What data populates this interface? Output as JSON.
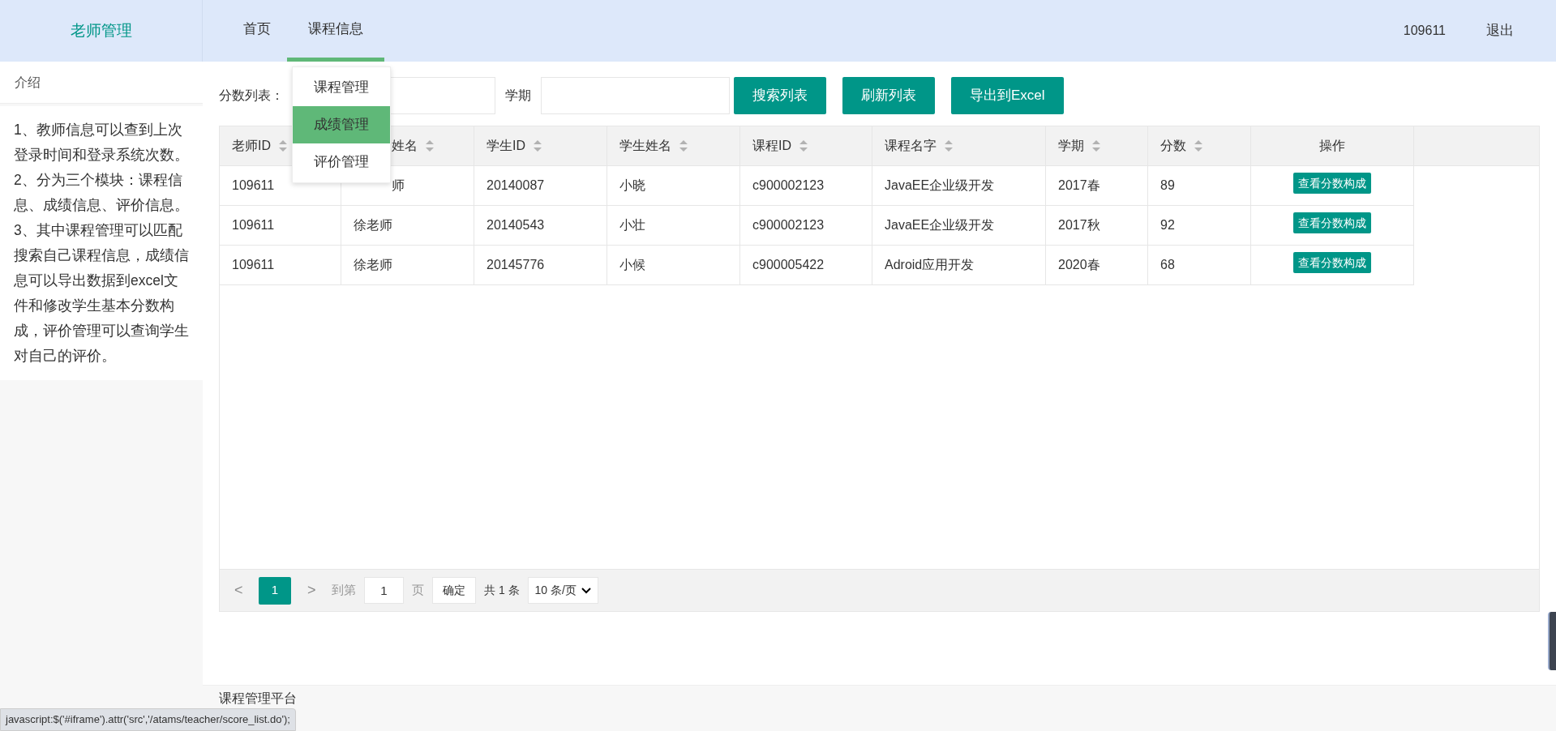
{
  "header": {
    "logo": "老师管理",
    "nav": [
      {
        "label": "首页",
        "selected": false
      },
      {
        "label": "课程信息",
        "selected": true
      }
    ],
    "user": "109611",
    "logout": "退出"
  },
  "dropdown": [
    {
      "label": "课程管理",
      "selected": false
    },
    {
      "label": "成绩管理",
      "selected": true
    },
    {
      "label": "评价管理",
      "selected": false
    }
  ],
  "sidebar": {
    "title": "介绍",
    "paragraphs": [
      "1、教师信息可以查到上次登录时间和登录系统次数。",
      "2、分为三个模块：课程信息、成绩信息、评价信息。",
      "3、其中课程管理可以匹配搜索自己课程信息，成绩信息可以导出数据到excel文件和修改学生基本分数构成，评价管理可以查询学生对自己的评价。"
    ]
  },
  "toolbar": {
    "label": "分数列表：",
    "term_label": "学期",
    "buttons": [
      "搜索列表",
      "刷新列表",
      "导出到Excel"
    ]
  },
  "table": {
    "columns": [
      {
        "label": "老师ID"
      },
      {
        "label": "姓名",
        "clipped": true
      },
      {
        "label": "学生ID"
      },
      {
        "label": "学生姓名"
      },
      {
        "label": "课程ID"
      },
      {
        "label": "课程名字"
      },
      {
        "label": "学期"
      },
      {
        "label": "分数"
      },
      {
        "label": "操作",
        "kind": "action"
      }
    ],
    "rows": [
      {
        "cells": [
          {
            "text": "109611"
          },
          {
            "text": "师",
            "clipped": true
          },
          {
            "text": "20140087"
          },
          {
            "text": "小晓"
          },
          {
            "text": "c900002123"
          },
          {
            "text": "JavaEE企业级开发"
          },
          {
            "text": "2017春"
          },
          {
            "text": "89"
          }
        ],
        "action": "查看分数构成"
      },
      {
        "cells": [
          {
            "text": "109611"
          },
          {
            "text": "徐老师"
          },
          {
            "text": "20140543"
          },
          {
            "text": "小壮"
          },
          {
            "text": "c900002123"
          },
          {
            "text": "JavaEE企业级开发"
          },
          {
            "text": "2017秋"
          },
          {
            "text": "92"
          }
        ],
        "action": "查看分数构成"
      },
      {
        "cells": [
          {
            "text": "109611"
          },
          {
            "text": "徐老师"
          },
          {
            "text": "20145776"
          },
          {
            "text": "小候"
          },
          {
            "text": "c900005422"
          },
          {
            "text": "Adroid应用开发"
          },
          {
            "text": "2020春"
          },
          {
            "text": "68"
          }
        ],
        "action": "查看分数构成"
      }
    ]
  },
  "pagination": {
    "prev": "<",
    "pages": [
      {
        "label": "1",
        "selected": true
      }
    ],
    "next": ">",
    "goto_label": "到第",
    "goto_value": "1",
    "page_unit": "页",
    "confirm": "确定",
    "total": "共 1 条",
    "page_size": "10 条/页"
  },
  "footer": "课程管理平台",
  "status_bar": "javascript:$('#iframe').attr('src','/atams/teacher/score_list.do');"
}
